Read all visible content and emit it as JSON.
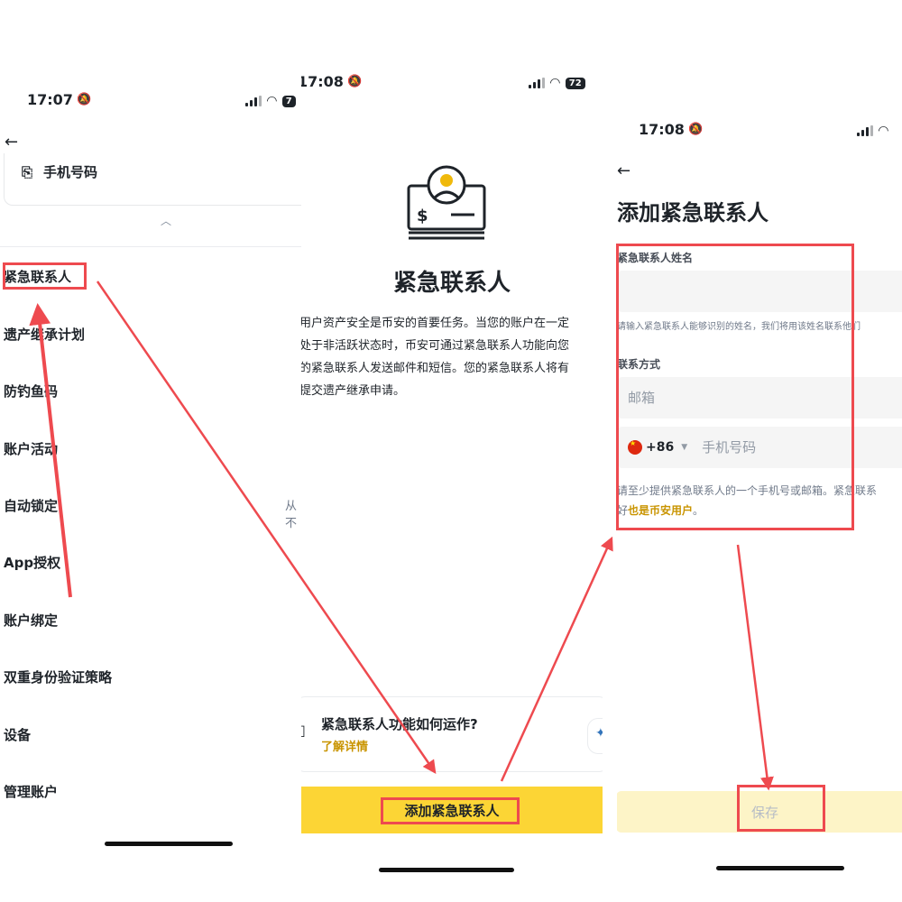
{
  "panel1": {
    "status_time": "17:07",
    "phone_label": "手机号码",
    "menu": [
      "紧急联系人",
      "遗产继承计划",
      "防钓鱼码",
      "账户活动",
      "自动锁定",
      "App授权",
      "账户绑定",
      "双重身份验证策略",
      "设备",
      "管理账户"
    ],
    "side_text": "从不"
  },
  "panel2": {
    "status_time": "17:08",
    "battery": "72",
    "hero_dollar": "$",
    "title": "紧急联系人",
    "description": [
      "用户资产安全是币安的首要任务。当您的账户在一定",
      "处于非活跃状态时，币安可通过紧急联系人功能向您",
      "的紧急联系人发送邮件和短信。您的紧急联系人将有",
      "提交遗产继承申请。"
    ],
    "info_title": "紧急联系人功能如何运作?",
    "info_link": "了解详情",
    "add_button": "添加紧急联系人"
  },
  "panel3": {
    "status_time": "17:08",
    "title": "添加紧急联系人",
    "name_label": "紧急联系人姓名",
    "name_hint": "请输入紧急联系人能够识别的姓名，我们将用该姓名联系他们",
    "contact_label": "联系方式",
    "email_placeholder": "邮箱",
    "country_code": "+86",
    "phone_placeholder": "手机号码",
    "hint_line1": "请至少提供紧急联系人的一个手机号或邮箱。紧急联系",
    "hint_line2_prefix": "好",
    "hint_line2_gold": "也是币安用户",
    "hint_line2_suffix": "。",
    "save_button": "保存"
  },
  "colors": {
    "accent_yellow": "#fcd535",
    "gold_text": "#c99400",
    "annotation_red": "#ee4a4f"
  }
}
